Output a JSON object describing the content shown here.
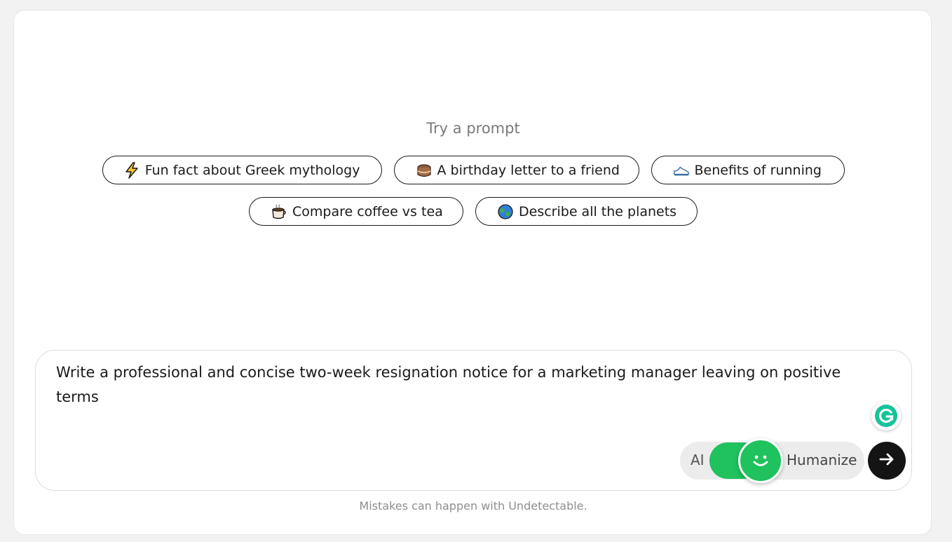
{
  "prompts": {
    "title": "Try a prompt",
    "chips": [
      {
        "label": "Fun fact about Greek mythology",
        "icon": "lightning-icon"
      },
      {
        "label": "A birthday letter to a friend",
        "icon": "cake-icon"
      },
      {
        "label": "Benefits of running",
        "icon": "running-shoe-icon"
      },
      {
        "label": "Compare coffee vs tea",
        "icon": "hot-beverage-icon"
      },
      {
        "label": "Describe all the planets",
        "icon": "globe-icon"
      }
    ]
  },
  "input": {
    "text": "Write a professional and concise two-week resignation notice for a marketing manager leaving on positive terms"
  },
  "toggle": {
    "left_label": "AI",
    "right_label": "Humanize",
    "state": "on",
    "accent": "#1fc25d"
  },
  "send": {
    "icon": "arrow-right-icon"
  },
  "footer": {
    "note": "Mistakes can happen with Undetectable."
  },
  "colors": {
    "page_bg": "#f2f2f2",
    "card_bg": "#ffffff",
    "send_bg": "#141414",
    "grammarly": "#15c39a"
  }
}
